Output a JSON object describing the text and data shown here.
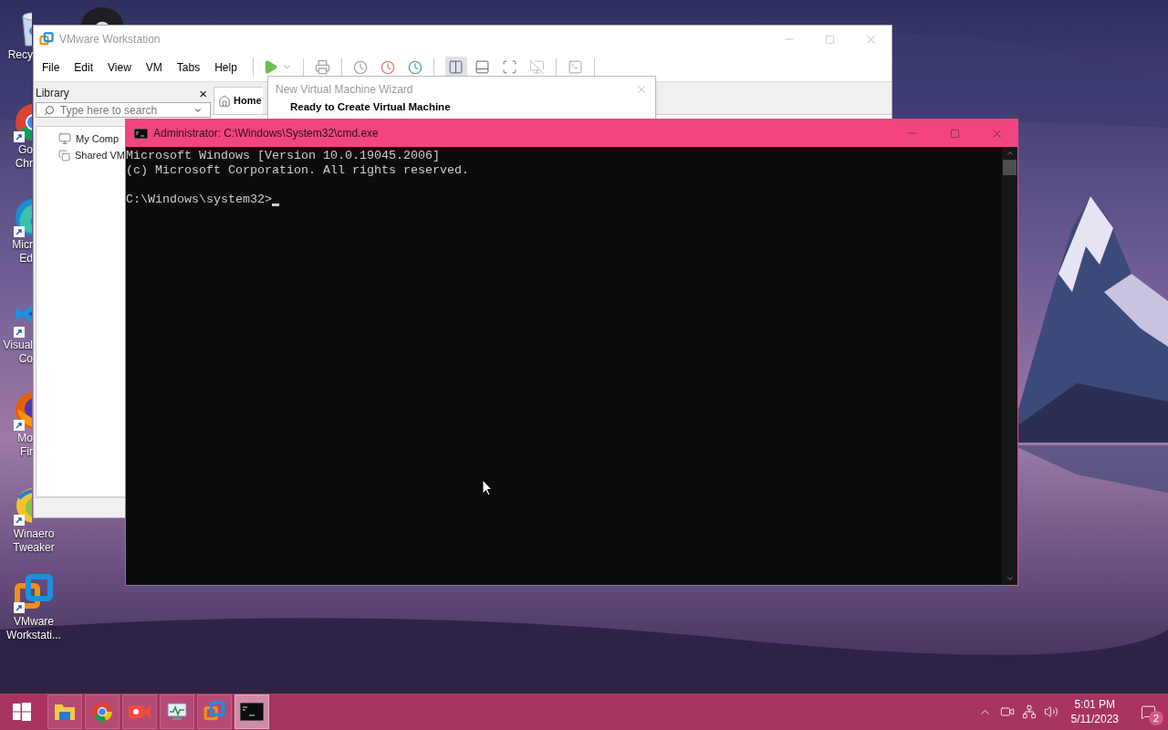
{
  "desktop_icons": [
    {
      "kind": "recycle",
      "lines": [
        "Recy"
      ]
    },
    {
      "kind": "chrome",
      "lines": [
        "Go",
        "Chr"
      ]
    },
    {
      "kind": "edge",
      "lines": [
        "Micr",
        "Ed"
      ]
    },
    {
      "kind": "vscode",
      "lines": [
        "Visual",
        "Co"
      ]
    },
    {
      "kind": "firefox",
      "lines": [
        "Mo",
        "Fir"
      ]
    },
    {
      "kind": "winaero",
      "lines": [
        "Winaero",
        "Tweaker"
      ]
    },
    {
      "kind": "vmware",
      "lines": [
        "VMware",
        "Workstati..."
      ]
    }
  ],
  "vmware": {
    "title": "VMware Workstation",
    "menu": [
      "File",
      "Edit",
      "View",
      "VM",
      "Tabs",
      "Help"
    ],
    "library": {
      "title": "Library",
      "close": "×",
      "search_placeholder": "Type here to search",
      "items": [
        "My Comp",
        "Shared VM"
      ]
    },
    "tabs": [
      {
        "label": "Home",
        "selected": true
      }
    ]
  },
  "wizard": {
    "title": "New Virtual Machine Wizard",
    "heading": "Ready to Create Virtual Machine"
  },
  "cmd": {
    "title": "Administrator: C:\\Windows\\System32\\cmd.exe",
    "output": [
      "Microsoft Windows [Version 10.0.19045.2006]",
      "(c) Microsoft Corporation. All rights reserved."
    ],
    "prompt": "C:\\Windows\\system32>"
  },
  "taskbar": {
    "apps": [
      {
        "kind": "explorer",
        "selected": false
      },
      {
        "kind": "chrome",
        "selected": false
      },
      {
        "kind": "recorder",
        "selected": false
      },
      {
        "kind": "monitor",
        "selected": false
      },
      {
        "kind": "vmware",
        "selected": false
      },
      {
        "kind": "cmd",
        "selected": true
      }
    ],
    "time": "5:01 PM",
    "date": "5/11/2023",
    "notifications": "2"
  }
}
